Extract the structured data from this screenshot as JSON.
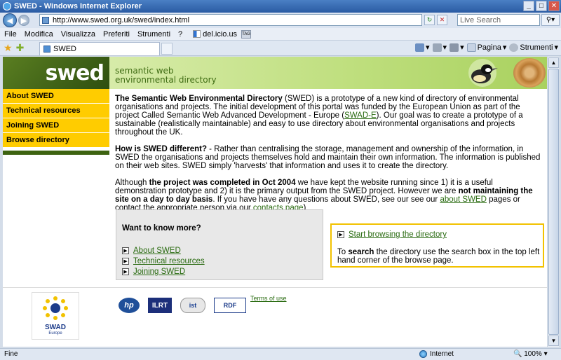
{
  "window": {
    "title": "SWED - Windows Internet Explorer"
  },
  "address": {
    "url": "http://www.swed.org.uk/swed/index.html",
    "search_placeholder": "Live Search"
  },
  "menu": [
    "File",
    "Modifica",
    "Visualizza",
    "Preferiti",
    "Strumenti",
    "?"
  ],
  "toolbar_extra": {
    "delicious": "del.icio.us",
    "tag": "TAG"
  },
  "tab": {
    "label": "SWED"
  },
  "commands": {
    "page": "Pagina",
    "tools": "Strumenti"
  },
  "site": {
    "logo": "swed",
    "banner_line1": "semantic web",
    "banner_line2": "environmental directory"
  },
  "sidebar": {
    "items": [
      {
        "label": "About SWED"
      },
      {
        "label": "Technical resources"
      },
      {
        "label": "Joining SWED"
      },
      {
        "label": "Browse directory"
      }
    ]
  },
  "content": {
    "p1_title": "The Semantic Web Environmental Directory",
    "p1_text_a": " (SWED) is a prototype of a new kind of directory of environmental organisations and projects. The initial development of this portal was funded by the European Union as part of the project Called Semantic Web Advanced Development - Europe (",
    "p1_link": "SWAD-E",
    "p1_text_b": "). Our goal was to create a prototype of a sustainable (realistically maintainable) and easy to use directory about environmental organisations and projects throughout the UK.",
    "p2_title": "How is SWED different?",
    "p2_text": " - Rather than centralising the storage, management and ownership of the information, in SWED the organisations and projects themselves hold and maintain their own information. The information is published on their web sites. SWED simply 'harvests' that information and uses it to create the directory.",
    "p3_a": "Although ",
    "p3_b": "the project was completed in Oct 2004",
    "p3_c": " we have kept the website running since 1) it is a useful demonstration prototype and 2) it is the primary output from the SWED project. However we are ",
    "p3_d": "not maintaining the site on a day to day basis",
    "p3_e": ". If you have have any questions about SWED, see our see our ",
    "p3_link1": "about SWED",
    "p3_f": " pages or contact the appropriate person via our ",
    "p3_link2": "contacts page",
    "p3_g": ")"
  },
  "more": {
    "heading": "Want to know more?",
    "links": [
      "About SWED",
      "Technical resources",
      "Joining SWED"
    ]
  },
  "browse": {
    "link": "Start browsing the directory",
    "text_a": "To ",
    "text_b": "search",
    "text_c": " the directory use the search box in the top left hand corner of the browse page."
  },
  "footer": {
    "swad": "SWAD",
    "europe": "Europe",
    "partners": [
      "hp",
      "ILRT",
      "ist",
      "RDF"
    ],
    "terms": "Terms of use"
  },
  "status": {
    "text": "Fine",
    "zone": "Internet",
    "zoom": "100%"
  }
}
